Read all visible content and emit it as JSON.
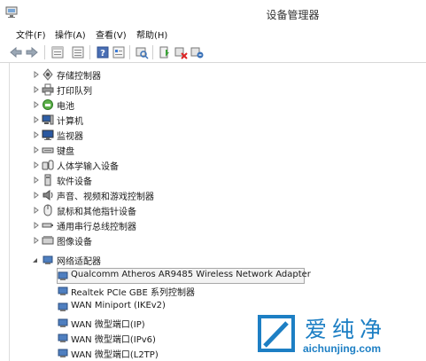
{
  "window": {
    "title": "设备管理器"
  },
  "menu": {
    "items": [
      "文件(F)",
      "操作(A)",
      "查看(V)",
      "帮助(H)"
    ]
  },
  "toolbar": {
    "icons": [
      "back-icon",
      "forward-icon",
      "view-icon",
      "list-icon",
      "help-icon",
      "properties-icon",
      "scan-icon",
      "update-driver-icon",
      "disable-device-icon",
      "uninstall-icon"
    ]
  },
  "tree": {
    "categories": [
      {
        "label": "存储控制器",
        "icon": "storage-controller-icon",
        "expanded": false
      },
      {
        "label": "打印队列",
        "icon": "printer-icon",
        "expanded": false
      },
      {
        "label": "电池",
        "icon": "battery-icon",
        "expanded": false
      },
      {
        "label": "计算机",
        "icon": "computer-icon",
        "expanded": false
      },
      {
        "label": "监视器",
        "icon": "monitor-icon",
        "expanded": false
      },
      {
        "label": "键盘",
        "icon": "keyboard-icon",
        "expanded": false
      },
      {
        "label": "人体学输入设备",
        "icon": "hid-icon",
        "expanded": false
      },
      {
        "label": "软件设备",
        "icon": "software-device-icon",
        "expanded": false
      },
      {
        "label": "声音、视频和游戏控制器",
        "icon": "sound-icon",
        "expanded": false
      },
      {
        "label": "鼠标和其他指针设备",
        "icon": "mouse-icon",
        "expanded": false
      },
      {
        "label": "通用串行总线控制器",
        "icon": "usb-icon",
        "expanded": false
      },
      {
        "label": "图像设备",
        "icon": "imaging-icon",
        "expanded": false
      },
      {
        "label": "网络适配器",
        "icon": "network-adapter-icon",
        "expanded": true
      }
    ],
    "network_adapters": [
      {
        "label": "Qualcomm Atheros AR9485 Wireless Network Adapter",
        "selected": true
      },
      {
        "label": "Realtek PCIe GBE 系列控制器",
        "selected": false
      },
      {
        "label": "WAN Miniport (IKEv2)",
        "selected": false
      },
      {
        "label": "WAN 微型端口(IP)",
        "selected": false
      },
      {
        "label": "WAN 微型端口(IPv6)",
        "selected": false
      },
      {
        "label": "WAN 微型端口(L2TP)",
        "selected": false
      }
    ]
  },
  "watermark": {
    "brand": "爱纯净",
    "url": "aichunjing.com",
    "color": "#1d7fc4"
  },
  "colors": {
    "accent": "#1d7fc4",
    "selection_border": "#a7a7a7",
    "selection_fill": "#f3f3f3"
  }
}
